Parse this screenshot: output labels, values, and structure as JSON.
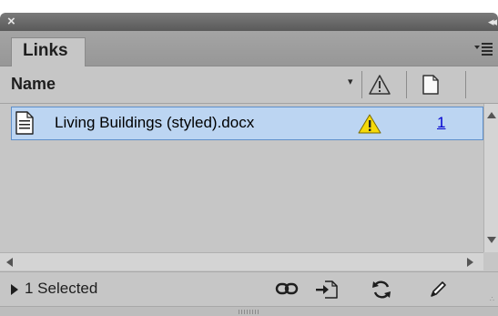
{
  "window": {
    "close_glyph": "×",
    "collapse_glyph": "◂◂"
  },
  "tabs": [
    {
      "label": "Links",
      "active": true
    }
  ],
  "panel_menu_icon": "panel-menu-icon",
  "columns": {
    "name_header": "Name",
    "sort_indicator": "▾",
    "status_icon": "warning-icon",
    "page_icon": "page-icon"
  },
  "links": [
    {
      "name": "Living Buildings (styled).docx",
      "status": "modified-warning",
      "page": "1",
      "selected": true,
      "file_icon": "document-icon"
    }
  ],
  "status": {
    "selection_text": "1 Selected"
  },
  "toolbar": {
    "buttons": [
      {
        "icon": "relink-icon"
      },
      {
        "icon": "go-to-link-icon"
      },
      {
        "icon": "update-link-icon"
      },
      {
        "icon": "edit-original-icon"
      }
    ]
  },
  "colors": {
    "selection_fill": "#bcd5f2",
    "selection_border": "#5f8fc9",
    "warning_fill": "#f5d90a",
    "page_link": "#0000d0",
    "panel_bg": "#c6c6c6"
  }
}
